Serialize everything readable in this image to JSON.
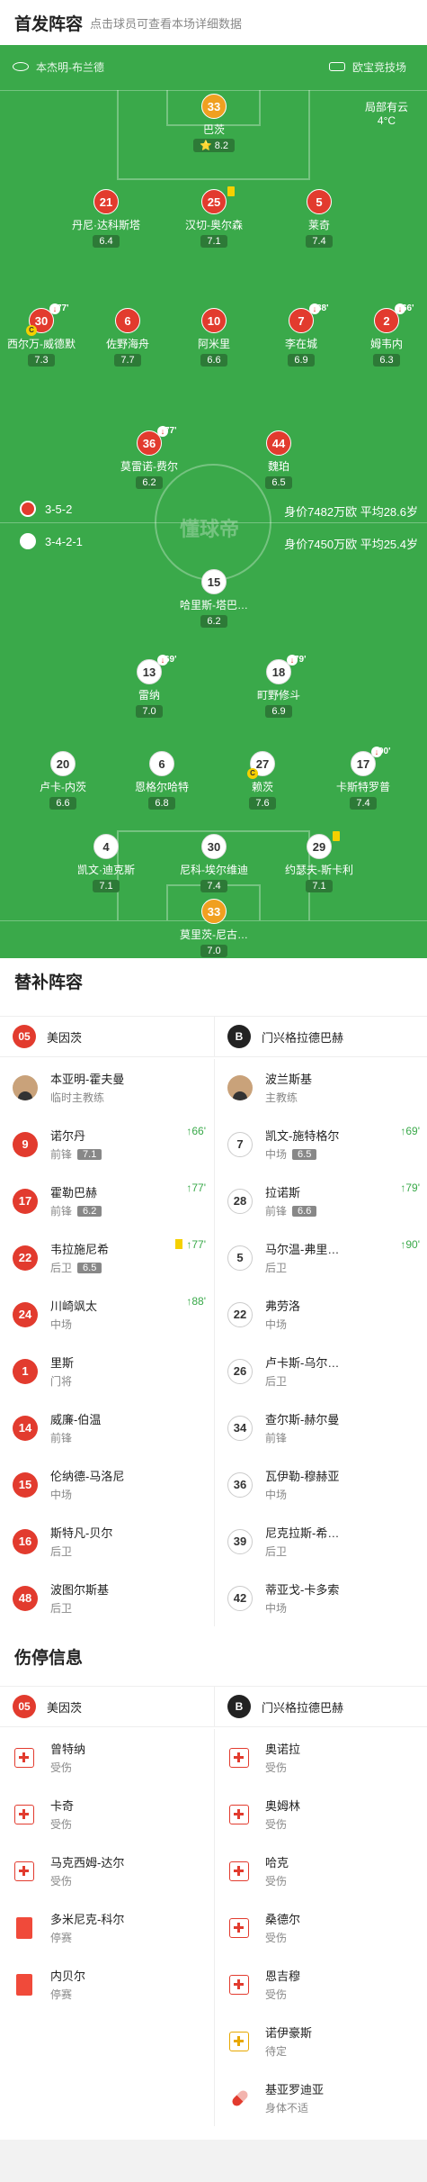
{
  "header": {
    "title": "首发阵容",
    "subtitle": "点击球员可查看本场详细数据"
  },
  "pitch": {
    "venue": "本杰明-布兰德",
    "tv": "欧宝竞技场",
    "weather": "局部有云",
    "temp": "4°C",
    "watermark": "懂球帝",
    "home_formation": "3-5-2",
    "home_value": "身价7482万欧 平均28.6岁",
    "away_formation": "3-4-2-1",
    "away_value": "身价7450万欧 平均25.4岁"
  },
  "home_xi": [
    {
      "num": "33",
      "name": "巴茨",
      "rating": "8.2",
      "star": "⭐"
    },
    {
      "num": "21",
      "name": "丹尼·达科斯塔",
      "rating": "6.4"
    },
    {
      "num": "25",
      "name": "汉切-奥尔森",
      "rating": "7.1"
    },
    {
      "num": "5",
      "name": "莱奇",
      "rating": "7.4"
    },
    {
      "num": "30",
      "name": "西尔万-威德默",
      "rating": "7.3",
      "min": "77'"
    },
    {
      "num": "6",
      "name": "佐野海舟",
      "rating": "7.7"
    },
    {
      "num": "10",
      "name": "阿米里",
      "rating": "6.6"
    },
    {
      "num": "7",
      "name": "李在城",
      "rating": "6.9",
      "min": "88'"
    },
    {
      "num": "2",
      "name": "姆韦内",
      "rating": "6.3",
      "min": "66'"
    },
    {
      "num": "36",
      "name": "莫雷诺-费尔",
      "rating": "6.2",
      "min": "77'"
    },
    {
      "num": "44",
      "name": "魏珀",
      "rating": "6.5"
    }
  ],
  "away_xi": [
    {
      "num": "15",
      "name": "哈里斯-塔巴…",
      "rating": "6.2"
    },
    {
      "num": "13",
      "name": "雷纳",
      "rating": "7.0",
      "min": "69'"
    },
    {
      "num": "18",
      "name": "町野修斗",
      "rating": "6.9",
      "min": "79'"
    },
    {
      "num": "20",
      "name": "卢卡-内茨",
      "rating": "6.6"
    },
    {
      "num": "6",
      "name": "恩格尔哈特",
      "rating": "6.8"
    },
    {
      "num": "27",
      "name": "赖茨",
      "rating": "7.6"
    },
    {
      "num": "17",
      "name": "卡斯特罗普",
      "rating": "7.4",
      "min": "90'"
    },
    {
      "num": "4",
      "name": "凯文·迪克斯",
      "rating": "7.1"
    },
    {
      "num": "30",
      "name": "尼科-埃尔维迪",
      "rating": "7.4"
    },
    {
      "num": "29",
      "name": "约瑟夫-斯卡利",
      "rating": "7.1"
    },
    {
      "num": "33",
      "name": "莫里茨-尼古…",
      "rating": "7.0"
    }
  ],
  "subs": {
    "title": "替补阵容",
    "home_team": "美因茨",
    "away_team": "门兴格拉德巴赫",
    "home_coach": {
      "name": "本亚明-霍夫曼",
      "role": "临时主教练"
    },
    "away_coach": {
      "name": "波兰斯基",
      "role": "主教练"
    },
    "home": [
      {
        "num": "9",
        "name": "诺尔丹",
        "pos": "前锋",
        "rating": "7.1",
        "in": "66'"
      },
      {
        "num": "17",
        "name": "霍勒巴赫",
        "pos": "前锋",
        "rating": "6.2",
        "in": "77'"
      },
      {
        "num": "22",
        "name": "韦拉施尼希",
        "pos": "后卫",
        "rating": "6.5",
        "in": "77'",
        "card": true
      },
      {
        "num": "24",
        "name": "川崎飒太",
        "pos": "中场",
        "in": "88'"
      },
      {
        "num": "1",
        "name": "里斯",
        "pos": "门将"
      },
      {
        "num": "14",
        "name": "威廉-伯温",
        "pos": "前锋"
      },
      {
        "num": "15",
        "name": "伦纳德-马洛尼",
        "pos": "中场"
      },
      {
        "num": "16",
        "name": "斯特凡-贝尔",
        "pos": "后卫"
      },
      {
        "num": "48",
        "name": "波图尔斯基",
        "pos": "后卫"
      }
    ],
    "away": [
      {
        "num": "7",
        "name": "凯文-施特格尔",
        "pos": "中场",
        "rating": "6.5",
        "in": "69'"
      },
      {
        "num": "28",
        "name": "拉诺斯",
        "pos": "前锋",
        "rating": "6.6",
        "in": "79'"
      },
      {
        "num": "5",
        "name": "马尔温-弗里…",
        "pos": "后卫",
        "in": "90'"
      },
      {
        "num": "22",
        "name": "弗劳洛",
        "pos": "中场"
      },
      {
        "num": "26",
        "name": "卢卡斯-乌尔…",
        "pos": "后卫"
      },
      {
        "num": "34",
        "name": "查尔斯-赫尔曼",
        "pos": "前锋"
      },
      {
        "num": "36",
        "name": "瓦伊勒-穆赫亚",
        "pos": "中场"
      },
      {
        "num": "39",
        "name": "尼克拉斯-希…",
        "pos": "后卫"
      },
      {
        "num": "42",
        "name": "蒂亚戈-卡多索",
        "pos": "中场"
      }
    ]
  },
  "injuries": {
    "title": "伤停信息",
    "home": [
      {
        "name": "曾特纳",
        "status": "受伤",
        "type": "injury"
      },
      {
        "name": "卡奇",
        "status": "受伤",
        "type": "injury"
      },
      {
        "name": "马克西姆-达尔",
        "status": "受伤",
        "type": "injury"
      },
      {
        "name": "多米尼克-科尔",
        "status": "停赛",
        "type": "suspension"
      },
      {
        "name": "内贝尔",
        "status": "停赛",
        "type": "suspension"
      }
    ],
    "away": [
      {
        "name": "奥诺拉",
        "status": "受伤",
        "type": "injury"
      },
      {
        "name": "奥姆林",
        "status": "受伤",
        "type": "injury"
      },
      {
        "name": "哈克",
        "status": "受伤",
        "type": "injury"
      },
      {
        "name": "桑德尔",
        "status": "受伤",
        "type": "injury"
      },
      {
        "name": "恩吉穆",
        "status": "受伤",
        "type": "injury"
      },
      {
        "name": "诺伊豪斯",
        "status": "待定",
        "type": "doubt"
      },
      {
        "name": "基亚罗迪亚",
        "status": "身体不适",
        "type": "ill"
      }
    ]
  },
  "colors": {
    "pitch": "#3aa94a",
    "home": "#e23b2e",
    "accent": "#f5d000"
  }
}
